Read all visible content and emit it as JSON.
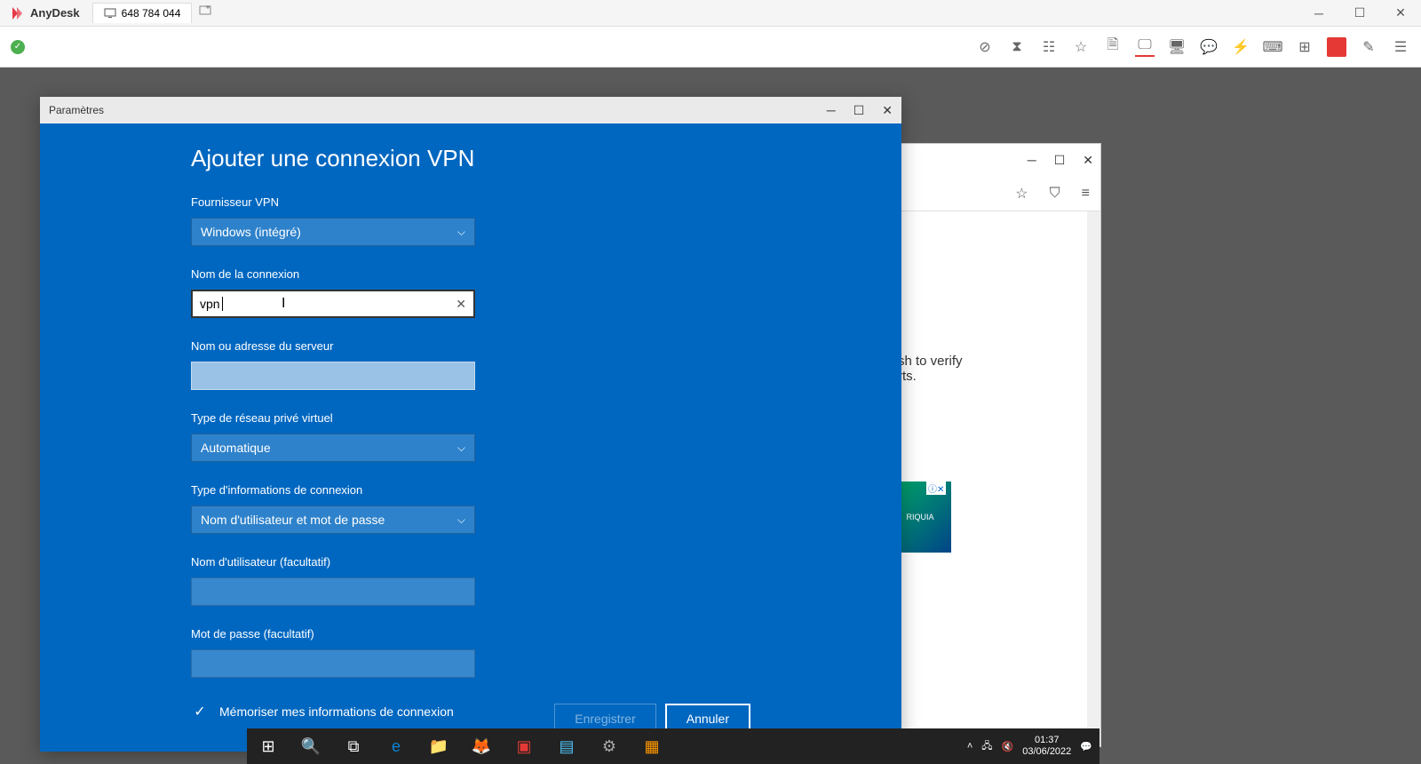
{
  "anydesk": {
    "brand": "AnyDesk",
    "tab_id": "648 784 044"
  },
  "settings": {
    "window_title": "Paramètres",
    "page_title": "Ajouter une connexion VPN",
    "provider_label": "Fournisseur VPN",
    "provider_value": "Windows (intégré)",
    "name_label": "Nom de la connexion",
    "name_value": "vpn ",
    "server_label": "Nom ou adresse du serveur",
    "server_value": "",
    "type_label": "Type de réseau privé virtuel",
    "type_value": "Automatique",
    "auth_label": "Type d'informations de connexion",
    "auth_value": "Nom d'utilisateur et mot de passe",
    "user_label": "Nom d'utilisateur (facultatif)",
    "user_value": "",
    "pass_label": "Mot de passe (facultatif)",
    "pass_value": "",
    "remember_label": "Mémoriser mes informations de connexion",
    "save_label": "Enregistrer",
    "cancel_label": "Annuler"
  },
  "firefox": {
    "text1": "sh to verify",
    "text2": "rts.",
    "ad_label": "RIQUIA",
    "ad_close": "✕"
  },
  "taskbar": {
    "time": "01:37",
    "date": "03/06/2022"
  }
}
